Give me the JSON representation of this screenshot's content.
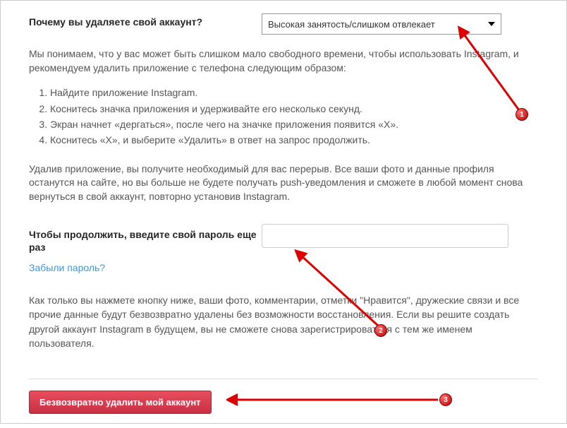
{
  "reason": {
    "label": "Почему вы удаляете свой аккаунт?",
    "selected": "Высокая занятость/слишком отвлекает"
  },
  "intro": "Мы понимаем, что у вас может быть слишком мало свободного времени, чтобы использовать Instagram, и рекомендуем удалить приложение с телефона следующим образом:",
  "steps": [
    "Найдите приложение Instagram.",
    "Коснитесь значка приложения и удерживайте его несколько секунд.",
    "Экран начнет «дергаться», после чего на значке приложения появится «X».",
    "Коснитесь «X», и выберите «Удалить» в ответ на запрос продолжить."
  ],
  "after_steps": "Удалив приложение, вы получите необходимый для вас перерыв. Все ваши фото и данные профиля останутся на сайте, но вы больше не будете получать push-уведомления и сможете в любой момент снова вернуться в свой аккаунт, повторно установив Instagram.",
  "password": {
    "label": "Чтобы продолжить, введите свой пароль еще раз",
    "forgot": "Забыли пароль?"
  },
  "warning": "Как только вы нажмете кнопку ниже, ваши фото, комментарии, отметки \"Нравится\", дружеские связи и все прочие данные будут безвозвратно удалены без возможности восстановления. Если вы решите создать другой аккаунт Instagram в будущем, вы не сможете снова зарегистрироваться с тем же именем пользователя.",
  "delete_button": "Безвозвратно удалить мой аккаунт",
  "annotations": {
    "badge1": "1",
    "badge2": "2",
    "badge3": "3"
  }
}
